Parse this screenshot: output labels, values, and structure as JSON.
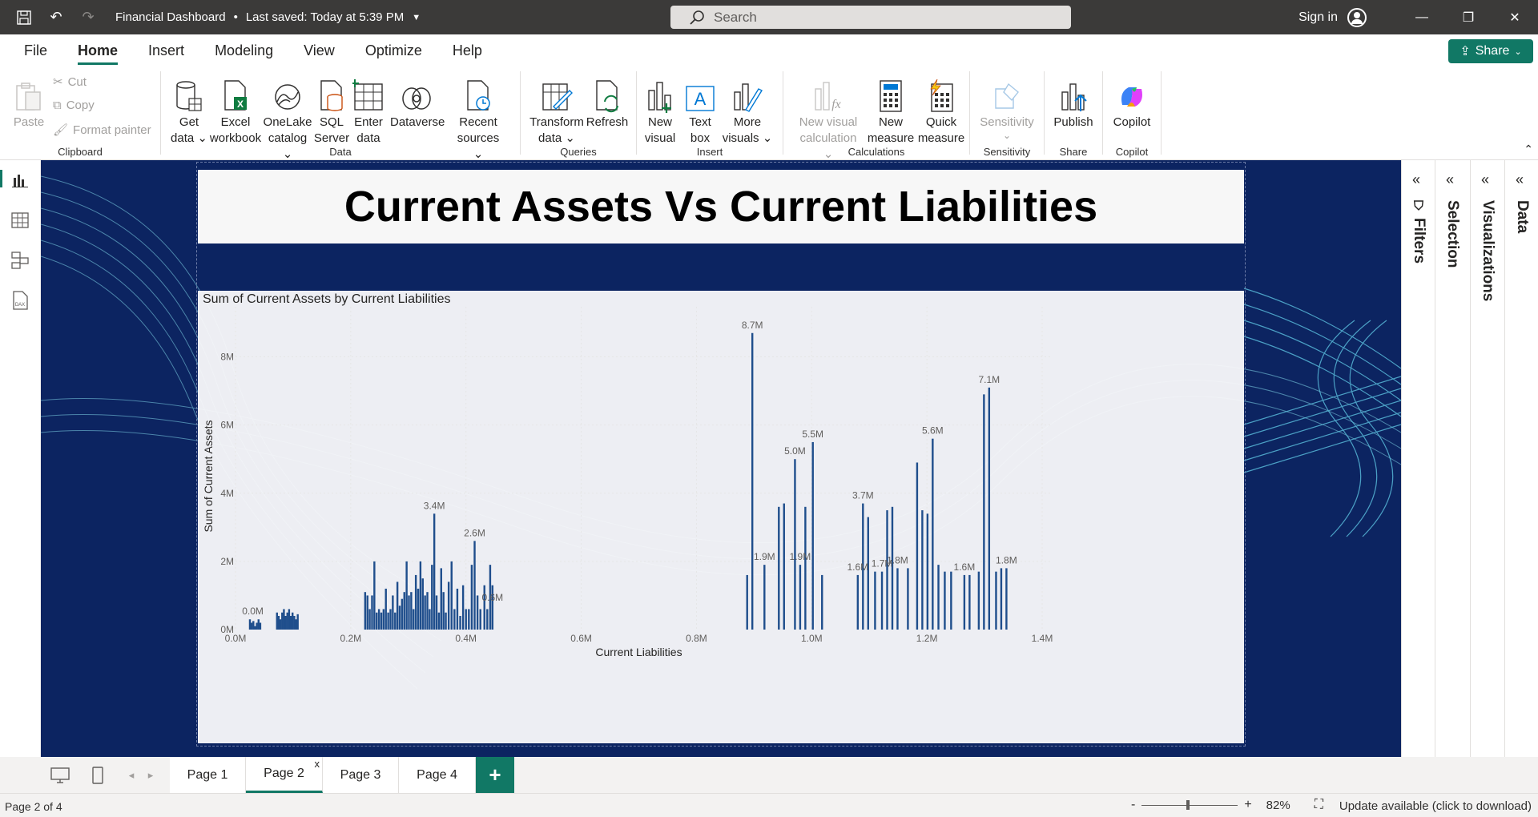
{
  "titlebar": {
    "file_name": "Financial Dashboard",
    "saved_status": "Last saved: Today at 5:39 PM",
    "search_placeholder": "Search",
    "sign_in": "Sign in"
  },
  "menu": {
    "items": [
      "File",
      "Home",
      "Insert",
      "Modeling",
      "View",
      "Optimize",
      "Help"
    ],
    "active": "Home",
    "share_label": "Share"
  },
  "ribbon": {
    "clipboard": {
      "paste": "Paste",
      "cut": "Cut",
      "copy": "Copy",
      "format_painter": "Format painter",
      "label": "Clipboard"
    },
    "data": {
      "get_data": [
        "Get",
        "data ⌄"
      ],
      "excel": [
        "Excel",
        "workbook"
      ],
      "onelake": [
        "OneLake",
        "catalog ⌄"
      ],
      "sql": [
        "SQL",
        "Server"
      ],
      "enter": [
        "Enter",
        "data"
      ],
      "dataverse": "Dataverse",
      "recent": [
        "Recent",
        "sources ⌄"
      ],
      "label": "Data"
    },
    "queries": {
      "transform": [
        "Transform",
        "data ⌄"
      ],
      "refresh": "Refresh",
      "label": "Queries"
    },
    "insert": {
      "new_visual": [
        "New",
        "visual"
      ],
      "text_box": [
        "Text",
        "box"
      ],
      "more_visuals": [
        "More",
        "visuals ⌄"
      ],
      "label": "Insert"
    },
    "calculations": {
      "new_visual_calc": [
        "New visual",
        "calculation ⌄"
      ],
      "new_measure": [
        "New",
        "measure"
      ],
      "quick_measure": [
        "Quick",
        "measure"
      ],
      "label": "Calculations"
    },
    "sensitivity": {
      "btn": "Sensitivity",
      "label": "Sensitivity"
    },
    "share": {
      "publish": "Publish",
      "label": "Share"
    },
    "copilot": {
      "btn": "Copilot",
      "label": "Copilot"
    }
  },
  "panes": [
    "Filters",
    "Selection",
    "Visualizations",
    "Data"
  ],
  "report": {
    "title": "Current Assets Vs Current Liabilities",
    "chart_title": "Sum of Current Assets by Current Liabilities"
  },
  "chart_data": {
    "type": "bar",
    "xlabel": "Current Liabilities",
    "ylabel": "Sum of Current Assets",
    "xlim": [
      0,
      1.4
    ],
    "ylim": [
      0,
      9
    ],
    "x_ticks": [
      "0.0M",
      "0.2M",
      "0.4M",
      "0.6M",
      "0.8M",
      "1.0M",
      "1.2M",
      "1.4M"
    ],
    "y_ticks": [
      "0M",
      "2M",
      "4M",
      "6M",
      "8M"
    ],
    "units": "M",
    "points": [
      [
        0.025,
        0.3
      ],
      [
        0.028,
        0.2
      ],
      [
        0.031,
        0.25
      ],
      [
        0.034,
        0.1
      ],
      [
        0.037,
        0.2
      ],
      [
        0.04,
        0.3
      ],
      [
        0.043,
        0.2
      ],
      [
        0.072,
        0.5
      ],
      [
        0.075,
        0.4
      ],
      [
        0.078,
        0.3
      ],
      [
        0.081,
        0.5
      ],
      [
        0.084,
        0.6
      ],
      [
        0.087,
        0.4
      ],
      [
        0.09,
        0.5
      ],
      [
        0.093,
        0.6
      ],
      [
        0.096,
        0.4
      ],
      [
        0.099,
        0.5
      ],
      [
        0.102,
        0.4
      ],
      [
        0.105,
        0.3
      ],
      [
        0.108,
        0.45
      ],
      [
        0.225,
        1.1
      ],
      [
        0.229,
        1.0
      ],
      [
        0.233,
        0.6
      ],
      [
        0.237,
        1.0
      ],
      [
        0.241,
        2.0
      ],
      [
        0.245,
        0.5
      ],
      [
        0.249,
        0.6
      ],
      [
        0.253,
        0.5
      ],
      [
        0.257,
        0.6
      ],
      [
        0.261,
        1.2
      ],
      [
        0.265,
        0.5
      ],
      [
        0.269,
        0.6
      ],
      [
        0.273,
        1.0
      ],
      [
        0.277,
        0.5
      ],
      [
        0.281,
        1.4
      ],
      [
        0.285,
        0.7
      ],
      [
        0.289,
        0.9
      ],
      [
        0.293,
        1.1
      ],
      [
        0.297,
        2.0
      ],
      [
        0.301,
        1.0
      ],
      [
        0.305,
        1.1
      ],
      [
        0.309,
        0.6
      ],
      [
        0.313,
        1.6
      ],
      [
        0.317,
        1.2
      ],
      [
        0.321,
        2.0
      ],
      [
        0.325,
        1.5
      ],
      [
        0.329,
        1.0
      ],
      [
        0.333,
        1.1
      ],
      [
        0.337,
        0.6
      ],
      [
        0.341,
        1.9
      ],
      [
        0.345,
        3.4
      ],
      [
        0.349,
        1.0
      ],
      [
        0.353,
        0.5
      ],
      [
        0.357,
        1.8
      ],
      [
        0.361,
        1.1
      ],
      [
        0.365,
        0.5
      ],
      [
        0.37,
        1.4
      ],
      [
        0.375,
        2.0
      ],
      [
        0.38,
        0.6
      ],
      [
        0.385,
        1.2
      ],
      [
        0.39,
        0.4
      ],
      [
        0.395,
        1.3
      ],
      [
        0.4,
        0.6
      ],
      [
        0.405,
        0.6
      ],
      [
        0.41,
        1.9
      ],
      [
        0.415,
        2.6
      ],
      [
        0.42,
        1.0
      ],
      [
        0.425,
        0.6
      ],
      [
        0.432,
        1.3
      ],
      [
        0.437,
        0.6
      ],
      [
        0.442,
        1.9
      ],
      [
        0.446,
        1.3
      ],
      [
        0.888,
        1.6
      ],
      [
        0.897,
        8.7
      ],
      [
        0.918,
        1.9
      ],
      [
        0.943,
        3.6
      ],
      [
        0.952,
        3.7
      ],
      [
        0.971,
        5.0
      ],
      [
        0.98,
        1.9
      ],
      [
        0.989,
        3.6
      ],
      [
        1.002,
        5.5
      ],
      [
        1.018,
        1.6
      ],
      [
        1.08,
        1.6
      ],
      [
        1.089,
        3.7
      ],
      [
        1.098,
        3.3
      ],
      [
        1.11,
        1.7
      ],
      [
        1.122,
        1.7
      ],
      [
        1.131,
        3.5
      ],
      [
        1.14,
        3.6
      ],
      [
        1.149,
        1.8
      ],
      [
        1.167,
        1.8
      ],
      [
        1.183,
        4.9
      ],
      [
        1.192,
        3.5
      ],
      [
        1.201,
        3.4
      ],
      [
        1.21,
        5.6
      ],
      [
        1.22,
        1.9
      ],
      [
        1.231,
        1.7
      ],
      [
        1.242,
        1.7
      ],
      [
        1.265,
        1.6
      ],
      [
        1.274,
        1.6
      ],
      [
        1.29,
        1.7
      ],
      [
        1.299,
        6.9
      ],
      [
        1.308,
        7.1
      ],
      [
        1.32,
        1.7
      ],
      [
        1.329,
        1.8
      ],
      [
        1.338,
        1.8
      ]
    ],
    "labels": [
      {
        "x": 0.03,
        "y": 0.3,
        "text": "0.0M"
      },
      {
        "x": 0.345,
        "y": 3.4,
        "text": "3.4M"
      },
      {
        "x": 0.415,
        "y": 2.6,
        "text": "2.6M"
      },
      {
        "x": 0.446,
        "y": 0.7,
        "text": "0.6M"
      },
      {
        "x": 0.897,
        "y": 8.7,
        "text": "8.7M"
      },
      {
        "x": 0.918,
        "y": 1.9,
        "text": "1.9M"
      },
      {
        "x": 0.971,
        "y": 5.0,
        "text": "5.0M"
      },
      {
        "x": 0.98,
        "y": 1.9,
        "text": "1.9M"
      },
      {
        "x": 1.002,
        "y": 5.5,
        "text": "5.5M"
      },
      {
        "x": 1.08,
        "y": 1.6,
        "text": "1.6M"
      },
      {
        "x": 1.089,
        "y": 3.7,
        "text": "3.7M"
      },
      {
        "x": 1.122,
        "y": 1.7,
        "text": "1.7M"
      },
      {
        "x": 1.149,
        "y": 1.8,
        "text": "1.8M"
      },
      {
        "x": 1.21,
        "y": 5.6,
        "text": "5.6M"
      },
      {
        "x": 1.265,
        "y": 1.6,
        "text": "1.6M"
      },
      {
        "x": 1.308,
        "y": 7.1,
        "text": "7.1M"
      },
      {
        "x": 1.338,
        "y": 1.8,
        "text": "1.8M"
      }
    ],
    "bar_color": "#1f4e8c",
    "grid": true
  },
  "pages": {
    "tabs": [
      "Page 1",
      "Page 2",
      "Page 3",
      "Page 4"
    ],
    "active": "Page 2",
    "close": "x",
    "add": "+"
  },
  "status": {
    "page_info": "Page 2 of 4",
    "zoom_minus": "-",
    "zoom_plus": "+",
    "zoom": "82%",
    "zoom_level": 0.82,
    "update": "Update available (click to download)"
  },
  "colors": {
    "accent": "#117865",
    "canvas_bg": "#0c2461",
    "titlebar": "#3b3a39"
  }
}
